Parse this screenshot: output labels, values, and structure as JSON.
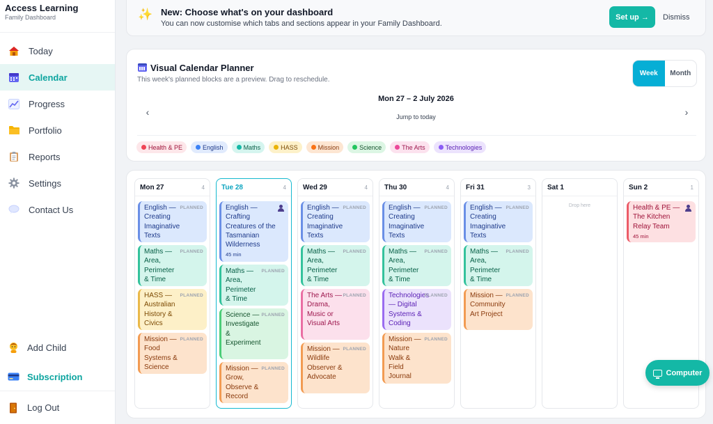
{
  "brand": {
    "title": "Access Learning",
    "subtitle": "Family Dashboard"
  },
  "sidebar": {
    "items": [
      {
        "label": "Today",
        "icon": "house-icon"
      },
      {
        "label": "Calendar",
        "icon": "calendar-icon",
        "active": true
      },
      {
        "label": "Progress",
        "icon": "chart-icon"
      },
      {
        "label": "Portfolio",
        "icon": "folder-icon"
      },
      {
        "label": "Reports",
        "icon": "clipboard-icon"
      },
      {
        "label": "Settings",
        "icon": "gear-icon"
      },
      {
        "label": "Contact Us",
        "icon": "speech-bubble-icon"
      }
    ],
    "bottom": [
      {
        "label": "Add Child",
        "icon": "child-icon"
      },
      {
        "label": "Subscription",
        "icon": "credit-card-icon"
      },
      {
        "label": "Log Out",
        "icon": "door-icon"
      }
    ]
  },
  "banner": {
    "title": "New: Choose what's on your dashboard",
    "subtitle": "You can now customise which tabs and sections appear in your Family Dashboard.",
    "setup_label": "Set up →",
    "dismiss_label": "Dismiss"
  },
  "planner": {
    "title": "Visual Calendar Planner",
    "subtitle": "This week's planned blocks are a preview. Drag to reschedule.",
    "view_options": [
      "Week",
      "Month"
    ],
    "active_view": "Week",
    "range": "Mon 27 – 2 July 2026",
    "jump_label": "Jump to today",
    "prev_icon": "‹",
    "next_icon": "›"
  },
  "legend": [
    {
      "label": "Health & PE",
      "color": "#ef4455",
      "bg": "#fde7ea",
      "text": "#9f1239"
    },
    {
      "label": "English",
      "color": "#3b82f6",
      "bg": "#e1ebfd",
      "text": "#1e3a8a"
    },
    {
      "label": "Maths",
      "color": "#14b8a6",
      "bg": "#d5f5ef",
      "text": "#065f46"
    },
    {
      "label": "HASS",
      "color": "#eab308",
      "bg": "#fdf1c9",
      "text": "#7c4a03"
    },
    {
      "label": "Mission",
      "color": "#f97316",
      "bg": "#fde6d2",
      "text": "#8a3a0c"
    },
    {
      "label": "Science",
      "color": "#22c55e",
      "bg": "#dcf6e4",
      "text": "#14532d"
    },
    {
      "label": "The Arts",
      "color": "#ec4899",
      "bg": "#fce2ee",
      "text": "#9d174d"
    },
    {
      "label": "Technologies",
      "color": "#8b5cf6",
      "bg": "#ece3fd",
      "text": "#5b21b6"
    }
  ],
  "tag_label": "PLANNED",
  "drop_label": "Drop here",
  "days": [
    {
      "name": "Mon 27",
      "count": "4",
      "blocks": [
        {
          "subject": "english",
          "text": "English — Creating Imaginative Texts"
        },
        {
          "subject": "maths",
          "text": "Maths — Area, Perimeter & Time"
        },
        {
          "subject": "hass",
          "text": "HASS — Australian History & Civics"
        },
        {
          "subject": "mission",
          "text": "Mission — Food Systems & Science"
        }
      ]
    },
    {
      "name": "Tue 28",
      "count": "4",
      "today": true,
      "blocks": [
        {
          "subject": "english",
          "text": "English — Crafting Creatures of the Tasmanian Wilderness",
          "duration": "45 min",
          "user": true
        },
        {
          "subject": "maths",
          "text": "Maths — Area, Perimeter & Time"
        },
        {
          "subject": "science",
          "text": "Science — Investigate & Experiment"
        },
        {
          "subject": "mission",
          "text": "Mission — Grow, Observe & Record"
        }
      ]
    },
    {
      "name": "Wed 29",
      "count": "4",
      "blocks": [
        {
          "subject": "english",
          "text": "English — Creating Imaginative Texts"
        },
        {
          "subject": "maths",
          "text": "Maths — Area, Perimeter & Time"
        },
        {
          "subject": "arts",
          "text": "The Arts — Drama, Music or Visual Arts"
        },
        {
          "subject": "mission",
          "text": "Mission — Wildlife Observer & Advocate"
        }
      ]
    },
    {
      "name": "Thu 30",
      "count": "4",
      "blocks": [
        {
          "subject": "english",
          "text": "English — Creating Imaginative Texts"
        },
        {
          "subject": "maths",
          "text": "Maths — Area, Perimeter & Time"
        },
        {
          "subject": "tech",
          "text": "Technologies — Digital Systems & Coding"
        },
        {
          "subject": "mission",
          "text": "Mission — Nature Walk & Field Journal"
        }
      ]
    },
    {
      "name": "Fri 31",
      "count": "3",
      "blocks": [
        {
          "subject": "english",
          "text": "English — Creating Imaginative Texts"
        },
        {
          "subject": "maths",
          "text": "Maths — Area, Perimeter & Time"
        },
        {
          "subject": "mission",
          "text": "Mission — Community Art Project"
        }
      ]
    },
    {
      "name": "Sat 1",
      "count": "",
      "empty": true,
      "blocks": []
    },
    {
      "name": "Sun 2",
      "count": "1",
      "blocks": [
        {
          "subject": "health",
          "text": "Health & PE — The Kitchen Relay Team",
          "duration": "45 min",
          "user": true
        }
      ]
    }
  ],
  "computer_label": "Computer"
}
